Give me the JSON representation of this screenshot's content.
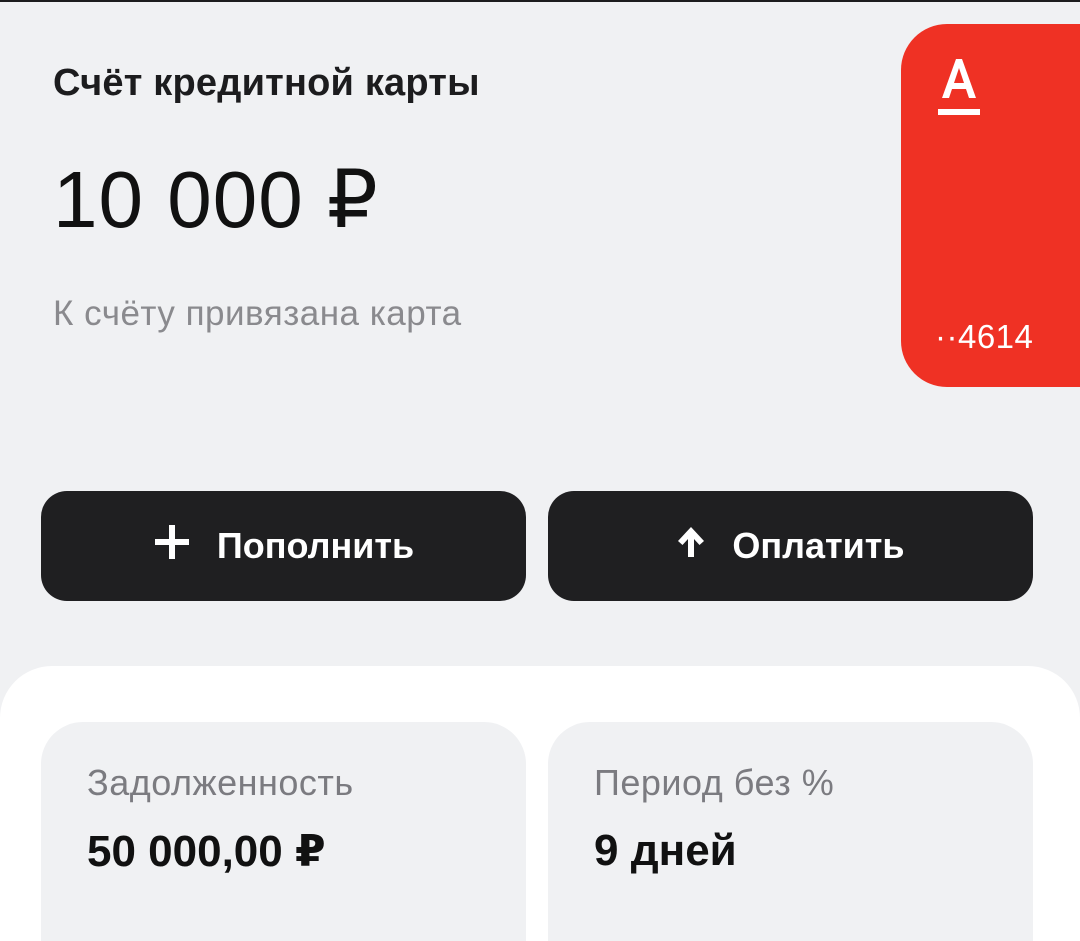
{
  "account": {
    "title": "Счёт кредитной карты",
    "balance": "10 000 ₽",
    "linked_card_text": "К счёту привязана карта"
  },
  "card": {
    "number_masked": "··4614",
    "color": "#ef3124",
    "logo_icon": "alfa-bank-logo-icon"
  },
  "actions": {
    "top_up": {
      "label": "Пополнить",
      "icon": "plus-icon"
    },
    "pay": {
      "label": "Оплатить",
      "icon": "arrow-up-icon"
    }
  },
  "info": {
    "debt": {
      "label": "Задолженность",
      "value": "50 000,00 ₽"
    },
    "grace_period": {
      "label": "Период без %",
      "value": "9 дней"
    }
  }
}
